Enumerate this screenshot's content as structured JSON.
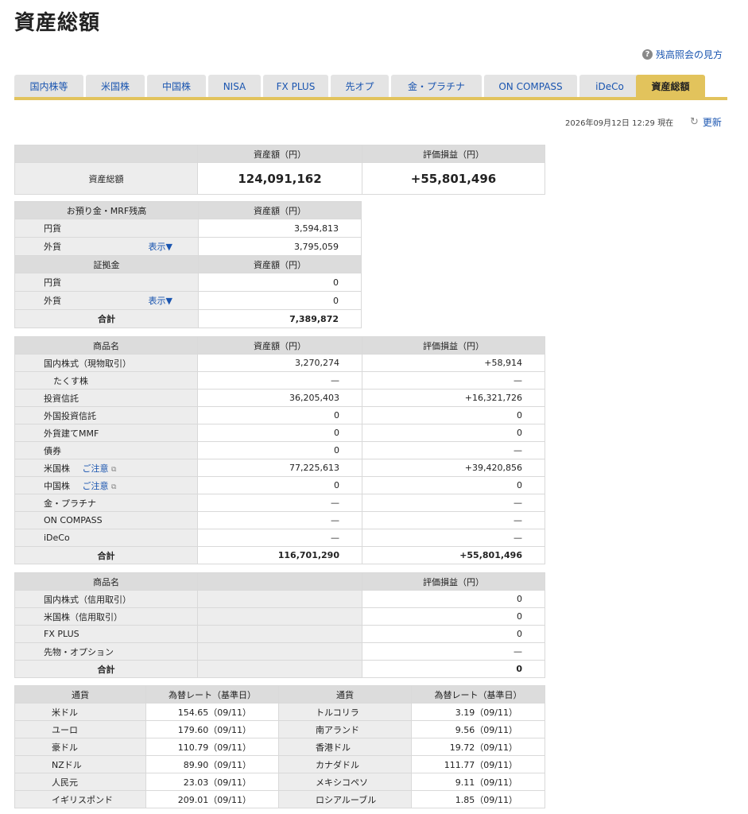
{
  "page": {
    "title": "資産総額",
    "help_label": "残高照会の見方",
    "updated": "2026年09月12日 12:29 現在",
    "refresh_label": "更新"
  },
  "tabs": [
    "国内株等",
    "米国株",
    "中国株",
    "NISA",
    "FX PLUS",
    "先オプ",
    "金・プラチナ",
    "ON COMPASS",
    "iDeCo",
    "資産総額"
  ],
  "summary": {
    "col1": "資産額（円）",
    "col2": "評価損益（円）",
    "label": "資産総額",
    "amount": "124,091,162",
    "pl": "+55,801,496"
  },
  "deposits": {
    "header_label": "お預り金・MRF残高",
    "header_value": "資産額（円）",
    "rows": [
      {
        "label": "円貨",
        "value": "3,594,813"
      },
      {
        "label": "外貨",
        "value": "3,795,059",
        "link": "表示▼"
      }
    ],
    "margin_label": "証拠金",
    "margin_value": "資産額（円）",
    "margin_rows": [
      {
        "label": "円貨",
        "value": "0"
      },
      {
        "label": "外貨",
        "value": "0",
        "link": "表示▼"
      }
    ],
    "total_label": "合計",
    "total_value": "7,389,872"
  },
  "products": {
    "col0": "商品名",
    "col1": "資産額（円）",
    "col2": "評価損益（円）",
    "rows": [
      {
        "label": "国内株式（現物取引）",
        "value": "3,270,274",
        "pl": "+58,914"
      },
      {
        "label": "たくす株",
        "value": "—",
        "pl": "—"
      },
      {
        "label": "投資信託",
        "value": "36,205,403",
        "pl": "+16,321,726"
      },
      {
        "label": "外国投資信託",
        "value": "0",
        "pl": "0"
      },
      {
        "label": "外貨建てMMF",
        "value": "0",
        "pl": "0"
      },
      {
        "label": "債券",
        "value": "0",
        "pl": "—"
      },
      {
        "label": "米国株",
        "note": "ご注意",
        "value": "77,225,613",
        "pl": "+39,420,856"
      },
      {
        "label": "中国株",
        "note": "ご注意",
        "value": "0",
        "pl": "0"
      },
      {
        "label": "金・プラチナ",
        "value": "—",
        "pl": "—"
      },
      {
        "label": "ON COMPASS",
        "value": "—",
        "pl": "—"
      },
      {
        "label": "iDeCo",
        "value": "—",
        "pl": "—"
      }
    ],
    "total_label": "合計",
    "total_value": "116,701,290",
    "total_pl": "+55,801,496"
  },
  "credit": {
    "col0": "商品名",
    "col2": "評価損益（円）",
    "rows": [
      {
        "label": "国内株式（信用取引）",
        "pl": "0"
      },
      {
        "label": "米国株（信用取引）",
        "pl": "0"
      },
      {
        "label": "FX PLUS",
        "pl": "0"
      },
      {
        "label": "先物・オプション",
        "pl": "—"
      }
    ],
    "total_label": "合計",
    "total_pl": "0"
  },
  "rates": {
    "col_currency": "通貨",
    "col_rate": "為替レート（基準日）",
    "left": [
      {
        "currency": "米ドル",
        "rate": "154.65（09/11）"
      },
      {
        "currency": "ユーロ",
        "rate": "179.60（09/11）"
      },
      {
        "currency": "豪ドル",
        "rate": "110.79（09/11）"
      },
      {
        "currency": "NZドル",
        "rate": "89.90（09/11）"
      },
      {
        "currency": "人民元",
        "rate": "23.03（09/11）"
      },
      {
        "currency": "イギリスポンド",
        "rate": "209.01（09/11）"
      }
    ],
    "right": [
      {
        "currency": "トルコリラ",
        "rate": "3.19（09/11）"
      },
      {
        "currency": "南アランド",
        "rate": "9.56（09/11）"
      },
      {
        "currency": "香港ドル",
        "rate": "19.72（09/11）"
      },
      {
        "currency": "カナダドル",
        "rate": "111.77（09/11）"
      },
      {
        "currency": "メキシコペソ",
        "rate": "9.11（09/11）"
      },
      {
        "currency": "ロシアルーブル",
        "rate": "1.85（09/11）"
      }
    ]
  }
}
